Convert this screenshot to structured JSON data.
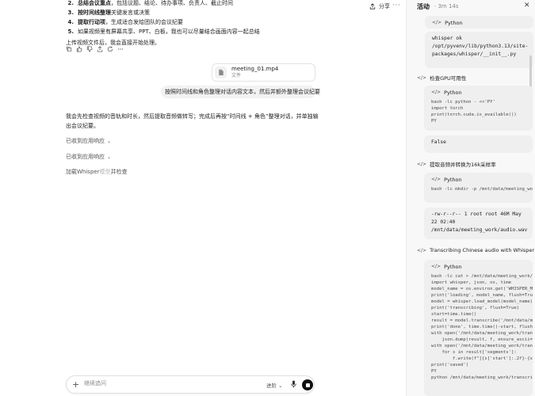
{
  "header": {
    "share_label": "分享"
  },
  "summary": {
    "items": [
      {
        "num": "2.",
        "bold": "总结会议重点",
        "rest": "，包括议题、结论、待办事项、负责人、截止时间"
      },
      {
        "num": "3.",
        "bold": "按时间线整理",
        "rest": "关键发言或决策"
      },
      {
        "num": "4.",
        "bold": "提取行动项",
        "rest": "，生成适合发给团队的会议纪要"
      },
      {
        "num": "5.",
        "bold": "",
        "rest": "如果视频里有屏幕共享、PPT、白板，我也可以尽量结合画面内容一起总结"
      }
    ],
    "note": "上传视频文件后，我会直接开始处理。"
  },
  "attachment": {
    "name": "meeting_01.mp4",
    "type": "文件"
  },
  "user_message": "按照时间线和角色整理对话内容文本，然后并额外整理会议纪要",
  "assistant_reply": "我会先检查视频的音轨和时长，然后提取音频做转写；完成后再按“时间线 + 角色”整理对话，并单独输出会议纪要。",
  "collapsed": [
    {
      "label": "已收到应用响应"
    },
    {
      "label": "已收到应用响应"
    }
  ],
  "loading": {
    "prefix": "加载Whisper",
    "dim": "模型",
    "suffix": "并检查"
  },
  "composer": {
    "placeholder": "继续追问",
    "mode_label": "进阶"
  },
  "panel": {
    "title": "活动",
    "time": "· 3m 14s",
    "blocks": [
      {
        "label": "Python"
      },
      {
        "label": "Python"
      },
      {
        "label": "Python"
      },
      {
        "label": "Python"
      }
    ],
    "outputs": {
      "whisper": "whisper ok\n/opt/pyvenv/lib/python3.13/site-\npackages/whisper/__init__.py",
      "gpu": "False",
      "ls": "-rw-r--r-- 1 root root 46M May\n22 02:40\n/mnt/data/meeting_work/audio.wav"
    },
    "steps": [
      {
        "label": "检查GPU可用性"
      },
      {
        "label": "提取音频并转换为16k采样率"
      },
      {
        "label": "Transcribing Chinese audio with Whisper"
      }
    ],
    "code": {
      "gpu": "bash -lc python - <<'PY'\nimport torch\nprint(torch.cuda.is_available())\nPY",
      "mkdir": "bash -lc mkdir -p /mnt/data/meeting_wo",
      "whisper": "bash -lc cat > /mnt/data/meeting_work/t\nimport whisper, json, os, time\nmodel_name = os.environ.get('WHISPER_MO\nprint('loading', model_name, flush=True\nmodel = whisper.load_model(model_name)\nprint('transcribing', flush=True)\nstart=time.time()\nresult = model.transcribe('/mnt/data/me\nprint('done', time.time()-start, flush=\nwith open('/mnt/data/meeting_work/trans\n    json.dump(result, f, ensure_ascii=\nwith open('/mnt/data/meeting_work/trans\n    for s in result['segments']:\n        f.write(f\"[{s['start']:.2f}-{s\nprint('saved')\nPY\npython /mnt/data/meeting_work/transcrib"
    }
  }
}
